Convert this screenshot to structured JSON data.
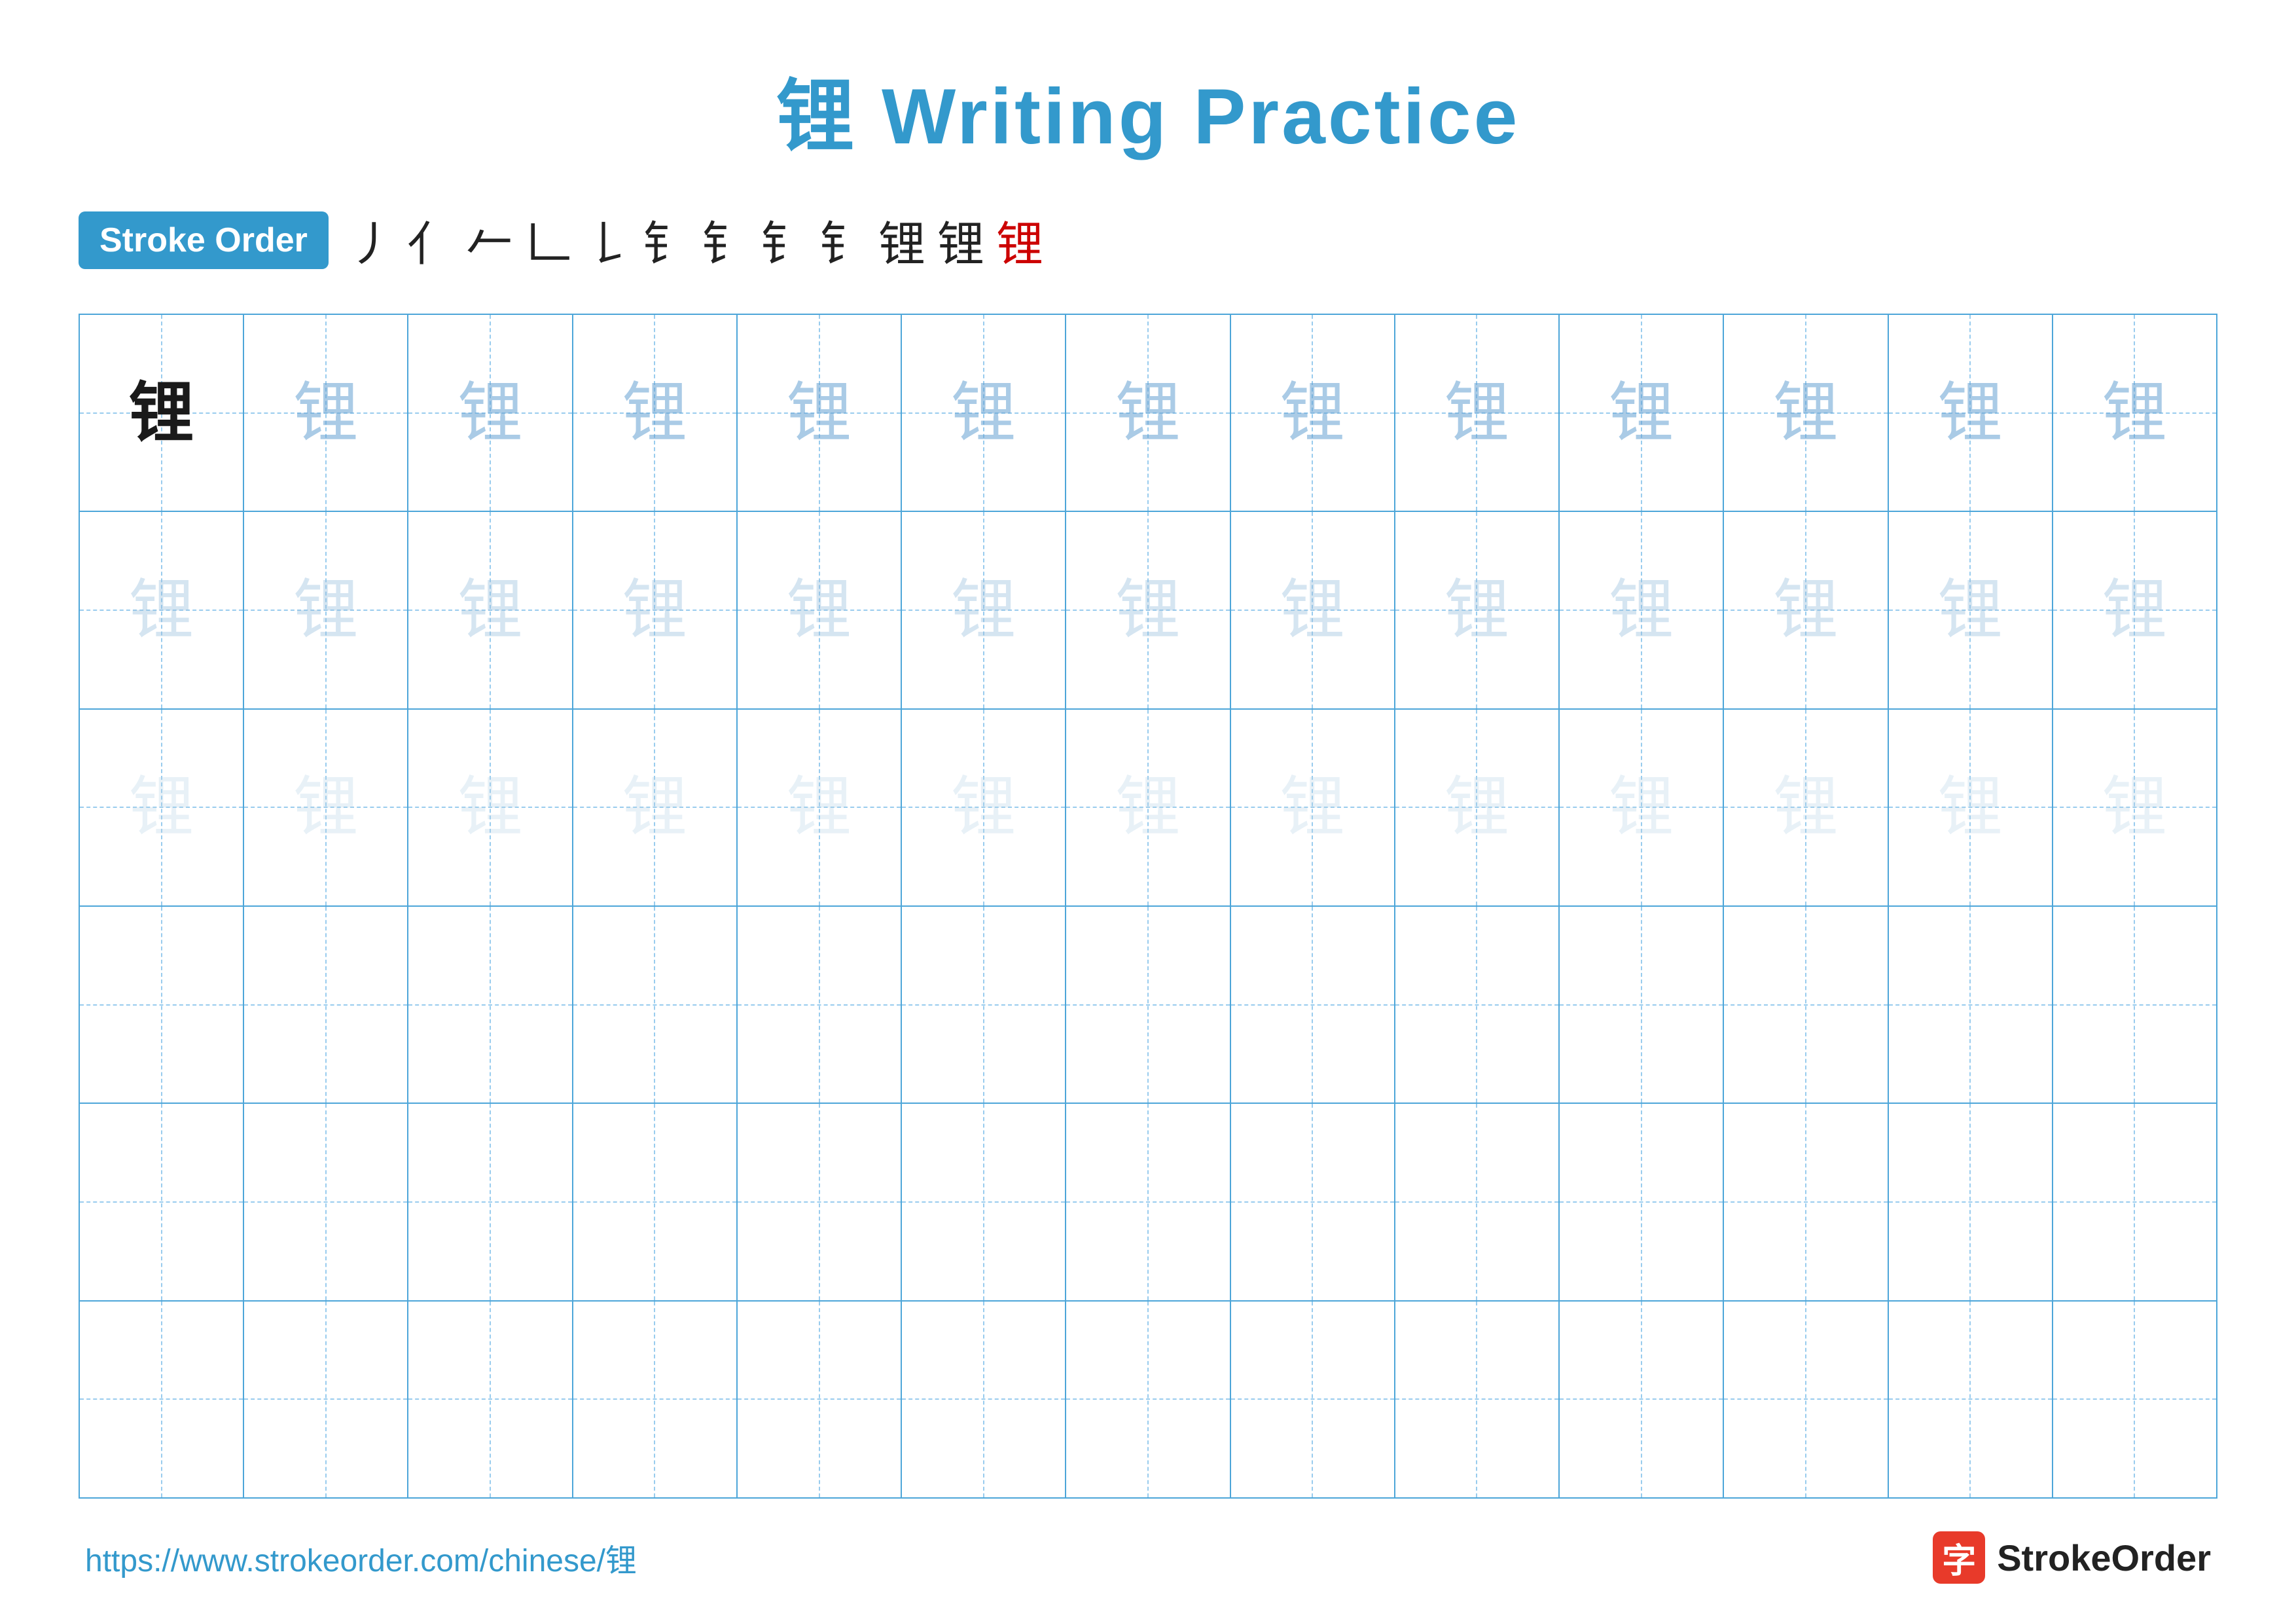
{
  "title": {
    "text": "锂 Writing Practice",
    "color": "#3399cc"
  },
  "stroke_order": {
    "badge_label": "Stroke Order",
    "strokes": [
      "丿",
      "亻",
      "𠂉",
      "𠃊",
      "𠄌",
      "钅",
      "钅𠃊",
      "钅𠃊",
      "钅钅",
      "锂-10",
      "锂-11",
      "锂"
    ]
  },
  "grid": {
    "rows": 6,
    "cols": 13,
    "character": "锂"
  },
  "footer": {
    "url": "https://www.strokeorder.com/chinese/锂",
    "brand_label": "StrokeOrder",
    "brand_icon": "字"
  }
}
